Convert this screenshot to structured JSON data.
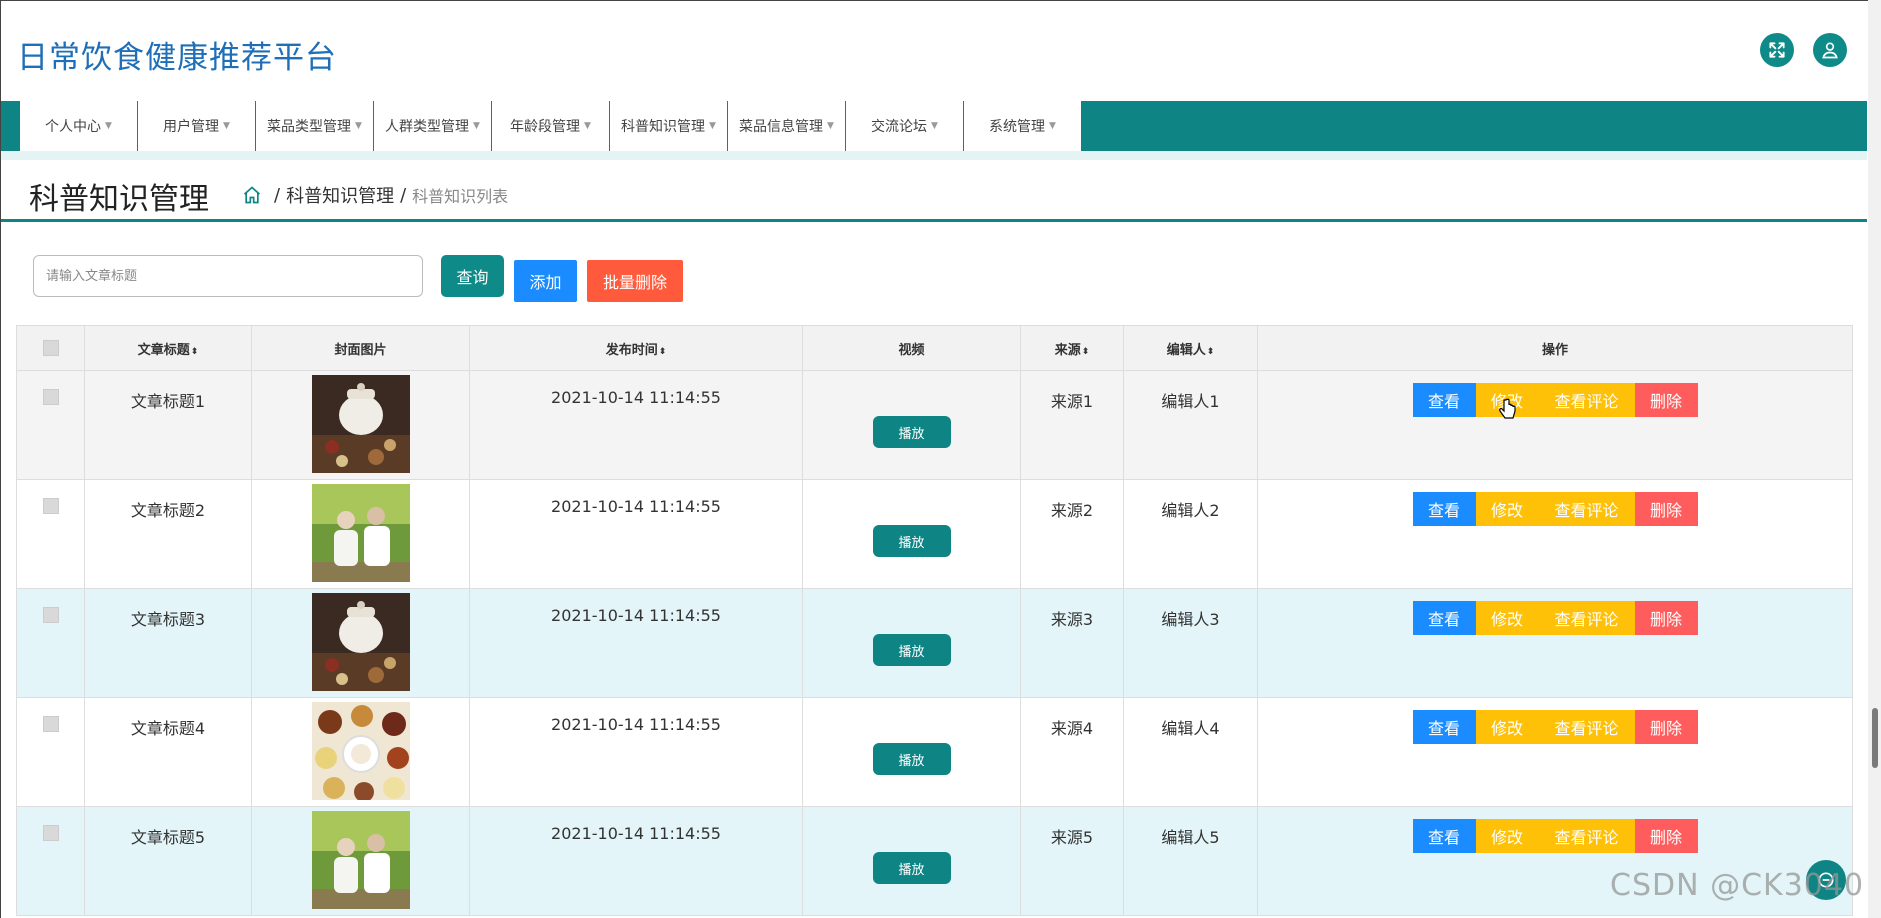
{
  "header": {
    "title": "日常饮食健康推荐平台",
    "fullscreen_icon": "expand-icon",
    "user_icon": "user-icon"
  },
  "nav": [
    {
      "label": "个人中心"
    },
    {
      "label": "用户管理"
    },
    {
      "label": "菜品类型管理"
    },
    {
      "label": "人群类型管理"
    },
    {
      "label": "年龄段管理"
    },
    {
      "label": "科普知识管理"
    },
    {
      "label": "菜品信息管理"
    },
    {
      "label": "交流论坛"
    },
    {
      "label": "系统管理"
    }
  ],
  "page": {
    "title": "科普知识管理",
    "breadcrumb": {
      "section": "科普知识管理",
      "current": "科普知识列表",
      "separator": "/"
    }
  },
  "toolbar": {
    "search_placeholder": "请输入文章标题",
    "query_label": "查询",
    "add_label": "添加",
    "batch_delete_label": "批量删除"
  },
  "table": {
    "columns": {
      "title": "文章标题",
      "cover": "封面图片",
      "publish_time": "发布时间",
      "video": "视频",
      "source": "来源",
      "editor": "编辑人",
      "actions": "操作"
    },
    "sort_glyph": "⬍",
    "rows": [
      {
        "title": "文章标题1",
        "cover": "herbal-pot-image",
        "publish_time": "2021-10-14 11:14:55",
        "play": "播放",
        "source": "来源1",
        "editor": "编辑人1"
      },
      {
        "title": "文章标题2",
        "cover": "elderly-couple-image",
        "publish_time": "2021-10-14 11:14:55",
        "play": "播放",
        "source": "来源2",
        "editor": "编辑人2"
      },
      {
        "title": "文章标题3",
        "cover": "herbal-pot-image",
        "publish_time": "2021-10-14 11:14:55",
        "play": "播放",
        "source": "来源3",
        "editor": "编辑人3"
      },
      {
        "title": "文章标题4",
        "cover": "grains-bowls-image",
        "publish_time": "2021-10-14 11:14:55",
        "play": "播放",
        "source": "来源4",
        "editor": "编辑人4"
      },
      {
        "title": "文章标题5",
        "cover": "elderly-couple-image",
        "publish_time": "2021-10-14 11:14:55",
        "play": "播放",
        "source": "来源5",
        "editor": "编辑人5"
      }
    ],
    "row_actions": {
      "view": "查看",
      "edit": "修改",
      "comments": "查看评论",
      "delete": "删除"
    }
  },
  "watermark": "CSDN @CK3040",
  "colors": {
    "primary": "#0e8484",
    "blue": "#1a8cff",
    "yellow": "#ffc107",
    "red": "#ff5d5d",
    "orange_red": "#ff5a3c"
  }
}
